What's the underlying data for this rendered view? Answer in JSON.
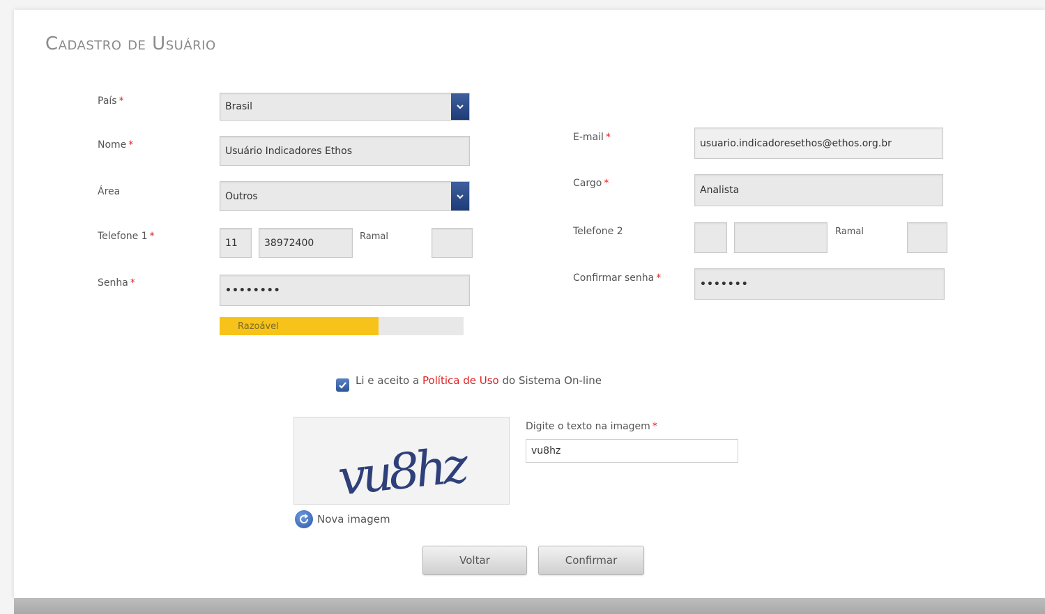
{
  "page": {
    "title": "Cadastro de Usuário"
  },
  "form": {
    "pais": {
      "label": "País",
      "value": "Brasil"
    },
    "nome": {
      "label": "Nome",
      "value": "Usuário Indicadores Ethos"
    },
    "area": {
      "label": "Área",
      "value": "Outros"
    },
    "telefone1": {
      "label": "Telefone 1",
      "ddd": "11",
      "number": "38972400",
      "ramal_label": "Ramal",
      "ramal": ""
    },
    "senha": {
      "label": "Senha",
      "value": "••••••••"
    },
    "strength": {
      "text": "Razoável",
      "level": 0.65,
      "color": "#f7c31a"
    },
    "email": {
      "label": "E-mail",
      "value": "usuario.indicadoresethos@ethos.org.br"
    },
    "cargo": {
      "label": "Cargo",
      "value": "Analista"
    },
    "telefone2": {
      "label": "Telefone 2",
      "ddd": "",
      "number": "",
      "ramal_label": "Ramal",
      "ramal": ""
    },
    "confirmar_senha": {
      "label": "Confirmar senha",
      "value": "•••••••"
    },
    "required_marker": "*"
  },
  "terms": {
    "checked": true,
    "prefix": "Li e aceito a",
    "link": "Política de Uso",
    "suffix": "do Sistema On-line"
  },
  "captcha": {
    "image_text": "vu8hz",
    "label": "Digite o texto na imagem",
    "value": "vu8hz",
    "refresh_label": "Nova imagem"
  },
  "buttons": {
    "back": "Voltar",
    "confirm": "Confirmar"
  },
  "colors": {
    "accent": "#1d3c78",
    "required": "#e02020",
    "strength": "#f7c31a"
  }
}
